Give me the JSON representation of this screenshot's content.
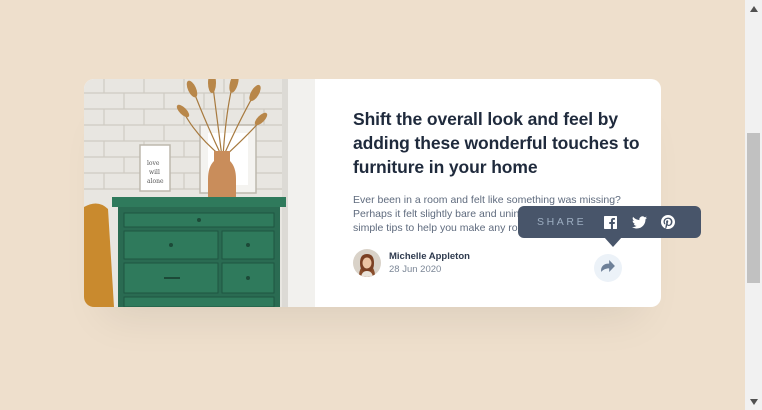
{
  "article": {
    "title": "Shift the overall look and feel by adding these wonderful touches to furniture in your home",
    "excerpt": "Ever been in a room and felt like something was missing? Perhaps it felt slightly bare and uninviting. I've got some simple tips to help you make any room feel complete.",
    "image_icon": "drawers-photo"
  },
  "author": {
    "name": "Michelle Appleton",
    "date": "28 Jun 2020",
    "avatar_icon": "avatar-photo"
  },
  "share": {
    "label": "SHARE",
    "icons": [
      "facebook-icon",
      "twitter-icon",
      "pinterest-icon"
    ],
    "button_icon": "share-icon"
  },
  "colors": {
    "background": "#EEDFCC",
    "tooltip": "#48556A",
    "share_button": "#ECF2F8",
    "title": "#1F2A3C"
  }
}
